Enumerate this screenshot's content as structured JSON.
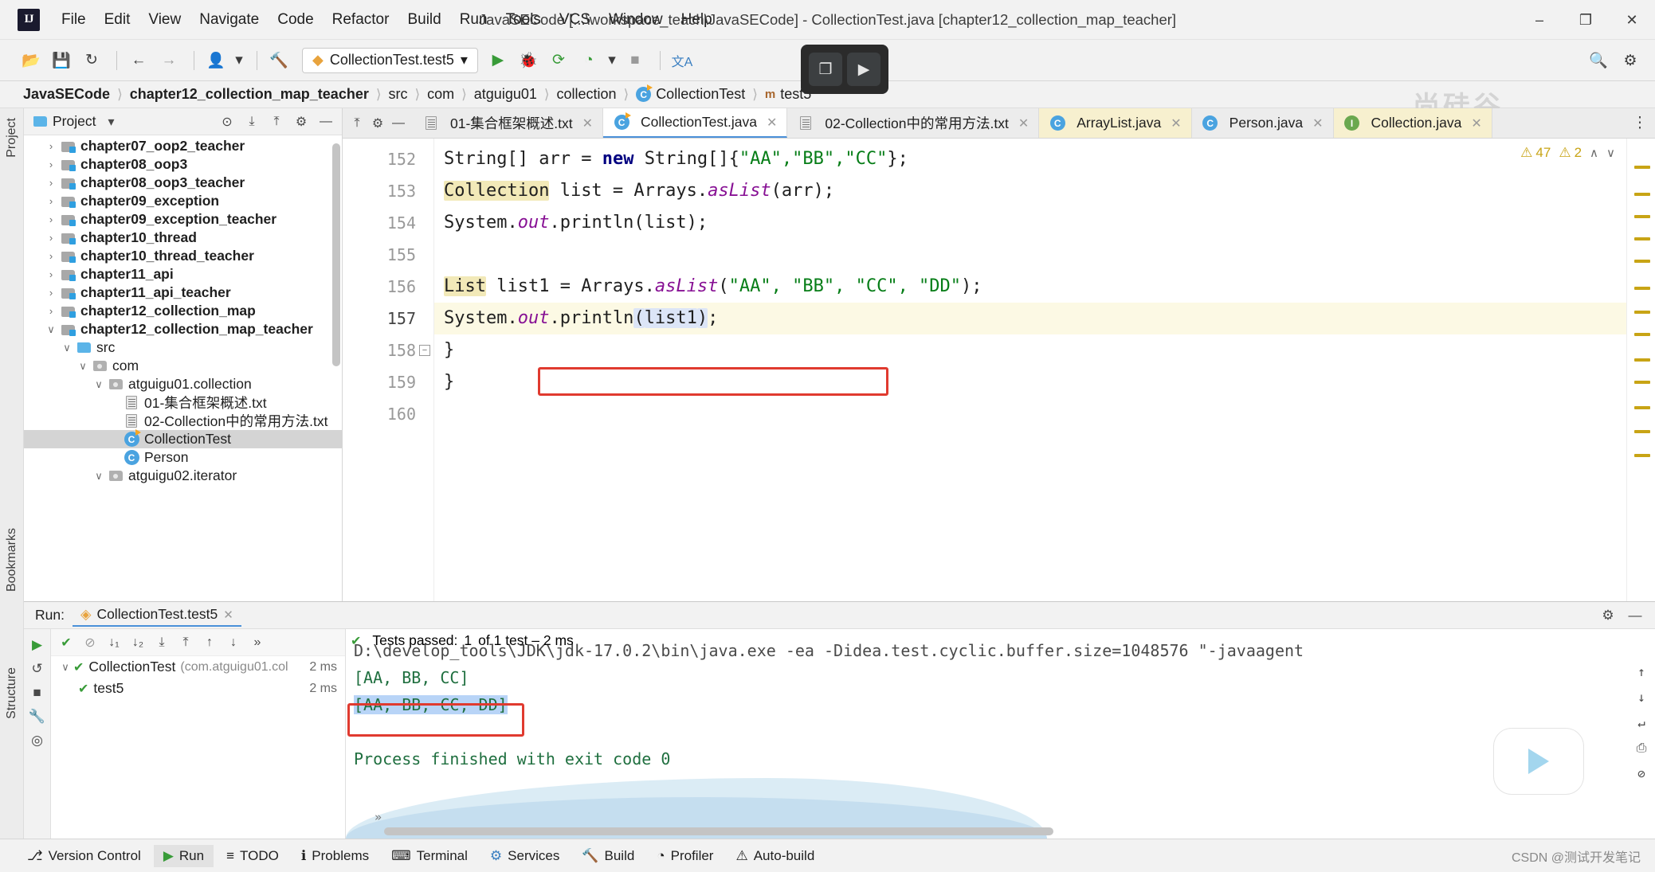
{
  "window": {
    "title": "JavaSECode [...\\workspace_teach\\JavaSECode] - CollectionTest.java [chapter12_collection_map_teacher]",
    "logo": "IJ",
    "minimize": "–",
    "maximize": "❐",
    "close": "✕"
  },
  "menu": [
    {
      "label": "File"
    },
    {
      "label": "Edit"
    },
    {
      "label": "View"
    },
    {
      "label": "Navigate"
    },
    {
      "label": "Code"
    },
    {
      "label": "Refactor"
    },
    {
      "label": "Build"
    },
    {
      "label": "Run"
    },
    {
      "label": "Tools"
    },
    {
      "label": "VCS"
    },
    {
      "label": "Window"
    },
    {
      "label": "Help"
    }
  ],
  "toolbar": {
    "open_icon": "📂",
    "save_icon": "💾",
    "sync_icon": "↻",
    "back_icon": "←",
    "forward_icon": "→",
    "profile_icon": "👤",
    "profile_caret": "▾",
    "build_icon": "🔨",
    "run_config": "CollectionTest.test5",
    "run_config_caret": "▾",
    "run_icon": "▶",
    "debug_icon": "🐞",
    "run_coverage_icon": "⟳",
    "profiler_icon": "◔",
    "profiler_caret": "▾",
    "stop_icon": "■",
    "translate_icon": "文A",
    "search_icon": "🔍",
    "settings_icon": "⚙",
    "widget_left_icon": "❐",
    "widget_right_icon": "▶",
    "watermark": "尚硅谷"
  },
  "breadcrumb": [
    {
      "label": "JavaSECode",
      "bold": true,
      "icon": ""
    },
    {
      "label": "chapter12_collection_map_teacher",
      "bold": true,
      "icon": ""
    },
    {
      "label": "src",
      "bold": false,
      "icon": ""
    },
    {
      "label": "com",
      "bold": false,
      "icon": ""
    },
    {
      "label": "atguigu01",
      "bold": false,
      "icon": ""
    },
    {
      "label": "collection",
      "bold": false,
      "icon": ""
    },
    {
      "label": "CollectionTest",
      "bold": false,
      "icon": "class"
    },
    {
      "label": "test5",
      "bold": false,
      "icon": "method"
    }
  ],
  "project_panel": {
    "title": "Project",
    "caret": "▾",
    "icon_target": "⊙",
    "icon_collapse_sel": "⤓",
    "icon_collapse_all": "⤒",
    "icon_settings": "⚙",
    "icon_hide": "—",
    "tree": [
      {
        "label": "chapter07_oop2_teacher",
        "indent": 1,
        "arrow": "›",
        "icon": "module",
        "bold": true,
        "selected": false
      },
      {
        "label": "chapter08_oop3",
        "indent": 1,
        "arrow": "›",
        "icon": "module",
        "bold": true,
        "selected": false
      },
      {
        "label": "chapter08_oop3_teacher",
        "indent": 1,
        "arrow": "›",
        "icon": "module",
        "bold": true,
        "selected": false
      },
      {
        "label": "chapter09_exception",
        "indent": 1,
        "arrow": "›",
        "icon": "module",
        "bold": true,
        "selected": false
      },
      {
        "label": "chapter09_exception_teacher",
        "indent": 1,
        "arrow": "›",
        "icon": "module",
        "bold": true,
        "selected": false
      },
      {
        "label": "chapter10_thread",
        "indent": 1,
        "arrow": "›",
        "icon": "module",
        "bold": true,
        "selected": false
      },
      {
        "label": "chapter10_thread_teacher",
        "indent": 1,
        "arrow": "›",
        "icon": "module",
        "bold": true,
        "selected": false
      },
      {
        "label": "chapter11_api",
        "indent": 1,
        "arrow": "›",
        "icon": "module",
        "bold": true,
        "selected": false
      },
      {
        "label": "chapter11_api_teacher",
        "indent": 1,
        "arrow": "›",
        "icon": "module",
        "bold": true,
        "selected": false
      },
      {
        "label": "chapter12_collection_map",
        "indent": 1,
        "arrow": "›",
        "icon": "module",
        "bold": true,
        "selected": false
      },
      {
        "label": "chapter12_collection_map_teacher",
        "indent": 1,
        "arrow": "∨",
        "icon": "module",
        "bold": true,
        "selected": false
      },
      {
        "label": "src",
        "indent": 2,
        "arrow": "∨",
        "icon": "src",
        "bold": false,
        "selected": false
      },
      {
        "label": "com",
        "indent": 3,
        "arrow": "∨",
        "icon": "pkg",
        "bold": false,
        "selected": false
      },
      {
        "label": "atguigu01.collection",
        "indent": 4,
        "arrow": "∨",
        "icon": "pkg",
        "bold": false,
        "selected": false
      },
      {
        "label": "01-集合框架概述.txt",
        "indent": 5,
        "arrow": "",
        "icon": "txt",
        "bold": false,
        "selected": false
      },
      {
        "label": "02-Collection中的常用方法.txt",
        "indent": 5,
        "arrow": "",
        "icon": "txt",
        "bold": false,
        "selected": false
      },
      {
        "label": "CollectionTest",
        "indent": 5,
        "arrow": "",
        "icon": "class-run",
        "bold": false,
        "selected": true
      },
      {
        "label": "Person",
        "indent": 5,
        "arrow": "",
        "icon": "class",
        "bold": false,
        "selected": false
      },
      {
        "label": "atguigu02.iterator",
        "indent": 4,
        "arrow": "∨",
        "icon": "pkg",
        "bold": false,
        "selected": false
      }
    ]
  },
  "editor": {
    "tabs": [
      {
        "label": "01-集合框架概述.txt",
        "icon": "txt",
        "active": false,
        "highlight": false,
        "close": "✕"
      },
      {
        "label": "CollectionTest.java",
        "icon": "class-run",
        "active": true,
        "highlight": false,
        "close": "✕"
      },
      {
        "label": "02-Collection中的常用方法.txt",
        "icon": "txt",
        "active": false,
        "highlight": false,
        "close": "✕"
      },
      {
        "label": "ArrayList.java",
        "icon": "class",
        "active": false,
        "highlight": true,
        "close": "✕"
      },
      {
        "label": "Person.java",
        "icon": "class",
        "active": false,
        "highlight": false,
        "close": "✕"
      },
      {
        "label": "Collection.java",
        "icon": "interface",
        "active": false,
        "highlight": true,
        "close": "✕"
      }
    ],
    "tabs_overflow_icon": "⋮",
    "line_numbers": [
      "152",
      "153",
      "154",
      "155",
      "156",
      "157",
      "158",
      "159",
      "160"
    ],
    "current_line": "157",
    "fold_icon": "−",
    "inspections": {
      "warning_icon": "⚠",
      "warning_count": "47",
      "weak_warning_icon": "⚠",
      "weak_warning_count": "2",
      "up_icon": "∧",
      "down_icon": "∨"
    },
    "code_lines": [
      {
        "n": "152",
        "segments": [
          {
            "t": "String[] ",
            "c": "typ"
          },
          {
            "t": "arr ",
            "c": "typ"
          },
          {
            "t": "= ",
            "c": "typ"
          },
          {
            "t": "new ",
            "c": "kw"
          },
          {
            "t": "String[]{",
            "c": "typ"
          },
          {
            "t": "\"AA\",\"BB\",\"CC\"",
            "c": "str"
          },
          {
            "t": "};",
            "c": "typ"
          }
        ]
      },
      {
        "n": "153",
        "segments": [
          {
            "t": "Collection",
            "c": "typ hl-yellow"
          },
          {
            "t": " list = Arrays.",
            "c": "typ"
          },
          {
            "t": "asList",
            "c": "fld"
          },
          {
            "t": "(arr);",
            "c": "typ"
          }
        ]
      },
      {
        "n": "154",
        "segments": [
          {
            "t": "System.",
            "c": "typ"
          },
          {
            "t": "out",
            "c": "fld"
          },
          {
            "t": ".println(list);",
            "c": "typ"
          }
        ]
      },
      {
        "n": "155",
        "segments": []
      },
      {
        "n": "156",
        "segments": [
          {
            "t": "List",
            "c": "typ hl-yellow"
          },
          {
            "t": " list1 = Arrays.",
            "c": "typ"
          },
          {
            "t": "asList",
            "c": "fld"
          },
          {
            "t": "(",
            "c": "typ"
          },
          {
            "t": "\"AA\", \"BB\", \"CC\", \"DD\"",
            "c": "str"
          },
          {
            "t": ");",
            "c": "typ"
          }
        ]
      },
      {
        "n": "157",
        "segments": [
          {
            "t": "System.",
            "c": "typ"
          },
          {
            "t": "out",
            "c": "fld"
          },
          {
            "t": ".println",
            "c": "typ"
          },
          {
            "t": "(",
            "c": "typ hl-ident"
          },
          {
            "t": "list1",
            "c": "typ hl-ident"
          },
          {
            "t": ")",
            "c": "typ hl-ident"
          },
          {
            "t": ";",
            "c": "typ"
          }
        ]
      },
      {
        "n": "158",
        "segments": [
          {
            "t": "}",
            "c": "typ"
          }
        ]
      },
      {
        "n": "159",
        "segments": [
          {
            "t": "}",
            "c": "typ"
          }
        ]
      },
      {
        "n": "160",
        "segments": []
      }
    ]
  },
  "run_window": {
    "label": "Run:",
    "tab_label": "CollectionTest.test5",
    "tab_icon": "◈",
    "tab_close": "✕",
    "settings_icon": "⚙",
    "hide_icon": "—",
    "toolbar_left": [
      {
        "name": "rerun",
        "icon": "▶"
      },
      {
        "name": "rerun-failed",
        "icon": "↺"
      },
      {
        "name": "stop",
        "icon": "■"
      },
      {
        "name": "wrench",
        "icon": "🔧"
      },
      {
        "name": "camera",
        "icon": "◎"
      }
    ],
    "tests_toolbar": [
      {
        "name": "passed-check",
        "icon": "✔"
      },
      {
        "name": "ignore-passed",
        "icon": "⊘"
      },
      {
        "name": "sort-alpha",
        "icon": "↓₁"
      },
      {
        "name": "sort-duration",
        "icon": "↓₂"
      },
      {
        "name": "expand-all",
        "icon": "⤓"
      },
      {
        "name": "collapse-all",
        "icon": "⤒"
      },
      {
        "name": "prev-failed",
        "icon": "↑"
      },
      {
        "name": "next-failed",
        "icon": "↓"
      },
      {
        "name": "more",
        "icon": "»"
      }
    ],
    "status": {
      "icon": "✔",
      "text": "Tests passed:",
      "count": "1",
      "of": "of 1 test – 2 ms"
    },
    "tests": [
      {
        "label": "CollectionTest",
        "pkg": "(com.atguigu01.col",
        "duration": "2 ms",
        "indent": 0,
        "arrow": "∨",
        "status": "✔"
      },
      {
        "label": "test5",
        "pkg": "",
        "duration": "2 ms",
        "indent": 1,
        "arrow": "",
        "status": "✔"
      }
    ],
    "console_lines": [
      {
        "text": "D:\\develop_tools\\JDK\\jdk-17.0.2\\bin\\java.exe -ea -Didea.test.cyclic.buffer.size=1048576 \"-javaagent",
        "style": "grey"
      },
      {
        "text": "[AA, BB, CC]",
        "style": "green"
      },
      {
        "text": "[AA, BB, CC, DD]",
        "style": "green-selected"
      },
      {
        "text": "",
        "style": "green"
      },
      {
        "text": "Process finished with exit code 0",
        "style": "green"
      }
    ],
    "more_icon": "»",
    "right_icons": [
      {
        "name": "up",
        "icon": "↑"
      },
      {
        "name": "down",
        "icon": "↓"
      },
      {
        "name": "soft-wrap",
        "icon": "↵"
      },
      {
        "name": "print",
        "icon": "⎙"
      },
      {
        "name": "clear-all",
        "icon": "⊘"
      }
    ]
  },
  "statusbar": {
    "items": [
      {
        "label": "Version Control",
        "icon": "⎇",
        "active": false
      },
      {
        "label": "Run",
        "icon": "▶",
        "active": true
      },
      {
        "label": "TODO",
        "icon": "≡",
        "active": false
      },
      {
        "label": "Problems",
        "icon": "ℹ",
        "active": false
      },
      {
        "label": "Terminal",
        "icon": "⌨",
        "active": false
      },
      {
        "label": "Services",
        "icon": "⚙",
        "active": false
      },
      {
        "label": "Build",
        "icon": "🔨",
        "active": false
      },
      {
        "label": "Profiler",
        "icon": "◔",
        "active": false
      },
      {
        "label": "Auto-build",
        "icon": "⚠",
        "active": false
      }
    ],
    "watermark": "CSDN @测试开发笔记"
  },
  "sidebar_vertical": {
    "project": "Project",
    "bookmarks": "Bookmarks",
    "structure": "Structure"
  },
  "colors": {
    "accent": "#4a90d9",
    "green": "#389b38",
    "red_box": "#e03a2f",
    "warning": "#c8a415",
    "console_green": "#1f6f3f"
  }
}
